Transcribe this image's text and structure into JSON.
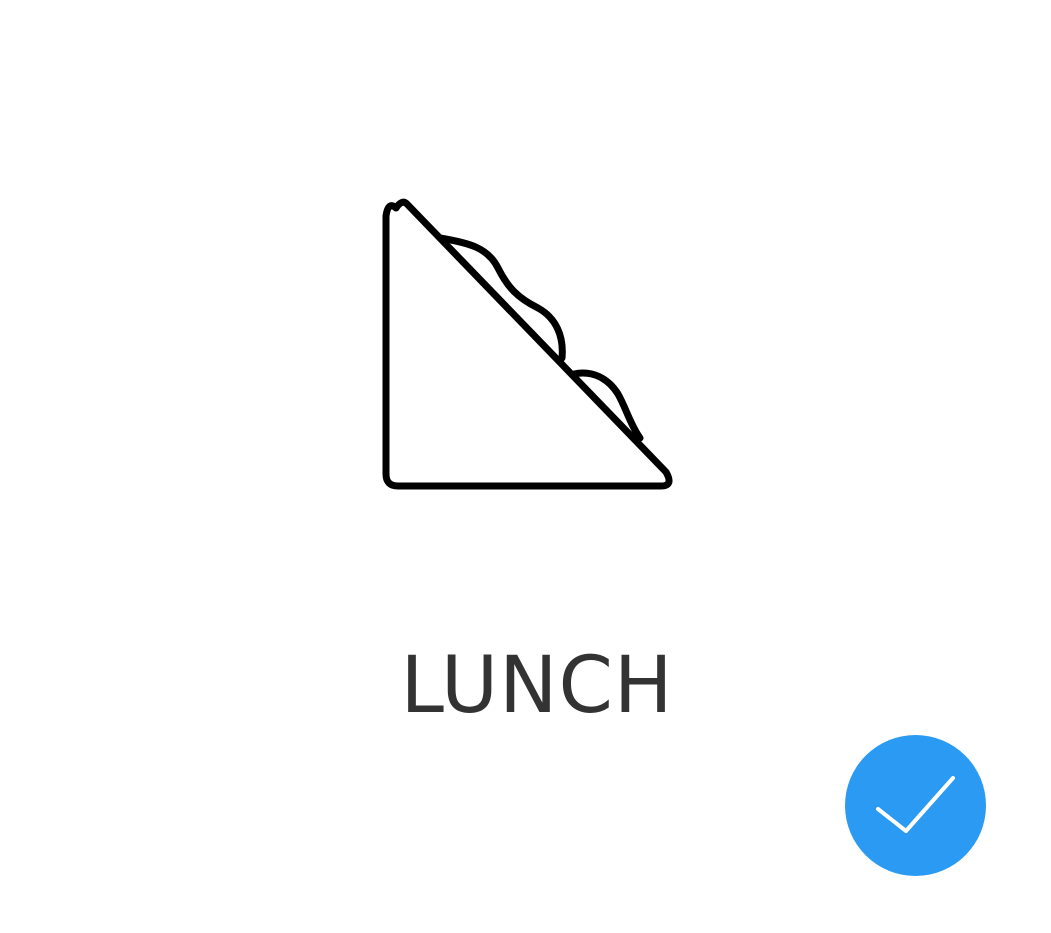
{
  "meal_option": {
    "label": "LUNCH",
    "icon": "sandwich-icon",
    "selected": true,
    "selected_icon": "checkmark-icon"
  },
  "colors": {
    "background": "#ffffff",
    "label": "#333333",
    "icon_stroke": "#000000",
    "badge_fill": "#2b9af3",
    "check_stroke": "#ffffff"
  }
}
